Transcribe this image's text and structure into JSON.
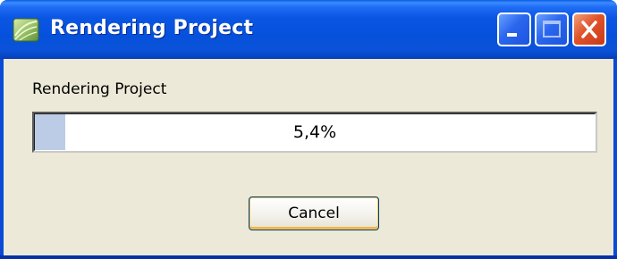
{
  "window": {
    "title": "Rendering Project",
    "app_icon": "app-leaf-icon",
    "title_buttons": {
      "minimize_icon": "minimize-icon",
      "maximize_icon": "maximize-icon",
      "close_icon": "close-icon"
    },
    "colors": {
      "titlebar": "#0a56e3",
      "client": "#ece9d8",
      "progress_fill": "#bccce6",
      "close_button": "#e0532a"
    }
  },
  "dialog": {
    "label": "Rendering Project",
    "progress": {
      "value_percent": 5.4,
      "text": "5,4%"
    },
    "cancel_label": "Cancel"
  }
}
